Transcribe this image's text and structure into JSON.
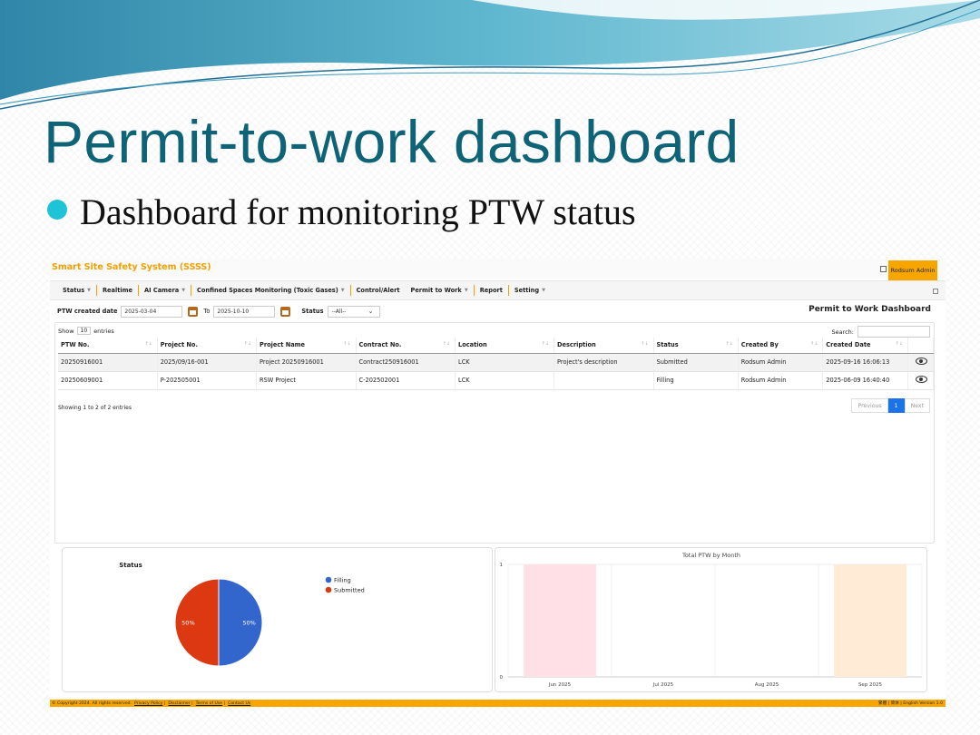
{
  "slide": {
    "title": "Permit-to-work dashboard",
    "bullet": "Dashboard for monitoring PTW status",
    "accent_color": "#0e6376",
    "bullet_color": "#1ec3d6"
  },
  "app": {
    "brand": "Smart Site Safety System (SSSS)",
    "user": "Rodsum Admin",
    "nav": [
      {
        "label": "Status",
        "dropdown": true
      },
      {
        "label": "Realtime",
        "dropdown": false
      },
      {
        "label": "AI Camera",
        "dropdown": true
      },
      {
        "label": "Confined Spaces Monitoring (Toxic Gases)",
        "dropdown": true
      },
      {
        "label": "Control/Alert",
        "dropdown": false
      },
      {
        "label": "Permit to Work",
        "dropdown": true
      },
      {
        "label": "Report",
        "dropdown": false
      },
      {
        "label": "Setting",
        "dropdown": true
      }
    ],
    "filter": {
      "created_label": "PTW created date",
      "from": "2025-03-04",
      "to_label": "To",
      "to": "2025-10-10",
      "status_label": "Status",
      "status_value": "--All--"
    },
    "dashboard_title": "Permit to Work Dashboard",
    "table": {
      "show_label": "Show",
      "show_value": "10",
      "entries_label": "entries",
      "search_label": "Search:",
      "columns": [
        "PTW No.",
        "Project No.",
        "Project Name",
        "Contract No.",
        "Location",
        "Description",
        "Status",
        "Created By",
        "Created Date"
      ],
      "rows": [
        [
          "20250916001",
          "2025/09/16-001",
          "Project 20250916001",
          "Contract250916001",
          "LCK",
          "Project's description",
          "Submitted",
          "Rodsum Admin",
          "2025-09-16 16:06:13"
        ],
        [
          "20250609001",
          "P-202505001",
          "RSW Project",
          "C-202502001",
          "LCK",
          "",
          "Filling",
          "Rodsum Admin",
          "2025-06-09 16:40:40"
        ]
      ],
      "info": "Showing 1 to 2 of 2 entries",
      "pager": {
        "previous": "Previous",
        "current": "1",
        "next": "Next"
      }
    },
    "footer": {
      "copyright": "© Copyright 2024. All rights reserved.",
      "links": [
        "Privacy Policy",
        "Disclaimer",
        "Terms of Use",
        "Contact Us"
      ],
      "right": "繁體 | 简体 | English   Version 1.0"
    }
  },
  "chart_data": [
    {
      "type": "pie",
      "title": "Status",
      "labels": [
        "Filling",
        "Submitted"
      ],
      "values": [
        50,
        50
      ],
      "colors": [
        "#3366cc",
        "#dc3912"
      ],
      "legend": "right"
    },
    {
      "type": "bar",
      "title": "Total PTW by Month",
      "categories": [
        "Jun 2025",
        "Jul 2025",
        "Aug 2025",
        "Sep 2025"
      ],
      "values": [
        1,
        0,
        0,
        1
      ],
      "colors": [
        "#ffe0e6",
        "#dff0fb",
        "#fff4dc",
        "#ffebd6"
      ],
      "ylim": [
        0,
        1
      ],
      "yticks": [
        "0",
        "1"
      ],
      "grid": true
    }
  ]
}
